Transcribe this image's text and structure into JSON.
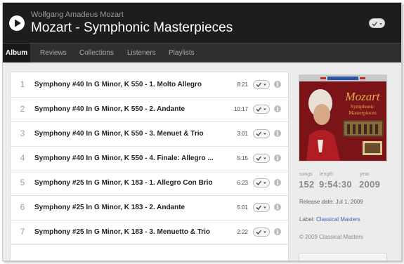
{
  "header": {
    "artist": "Wolfgang Amadeus Mozart",
    "album_title": "Mozart - Symphonic Masterpieces",
    "play_icon": "play-icon",
    "library_toggle_icon": "check-toggle-icon"
  },
  "tabs": [
    {
      "label": "Album",
      "active": true
    },
    {
      "label": "Reviews",
      "active": false
    },
    {
      "label": "Collections",
      "active": false
    },
    {
      "label": "Listeners",
      "active": false
    },
    {
      "label": "Playlists",
      "active": false
    }
  ],
  "tracks": [
    {
      "num": "1",
      "title": "Symphony #40 In G Minor, K 550 - 1. Molto Allegro",
      "duration": "8:21"
    },
    {
      "num": "2",
      "title": "Symphony #40 In G Minor, K 550 - 2. Andante",
      "duration": "10:17"
    },
    {
      "num": "3",
      "title": "Symphony #40 In G Minor, K 550 - 3. Menuet & Trio",
      "duration": "3:01"
    },
    {
      "num": "4",
      "title": "Symphony #40 In G Minor, K 550 - 4. Finale: Allegro ...",
      "duration": "5:15"
    },
    {
      "num": "5",
      "title": "Symphony #25 In G Minor, K 183 - 1. Allegro Con Brio",
      "duration": "6:23"
    },
    {
      "num": "6",
      "title": "Symphony #25 In G Minor, K 183 - 2. Andante",
      "duration": "5:01"
    },
    {
      "num": "7",
      "title": "Symphony #25 In G Minor, K 183 - 3. Menuetto & Trio",
      "duration": "2:22"
    }
  ],
  "cover": {
    "top_text": "Symphonic Masterpieces",
    "composer": "Mozart",
    "subtitle": "Symphonic Masterpieces",
    "colors": {
      "background": "#7a1418",
      "gold": "#e3b04a",
      "portrait": "#c8a070"
    }
  },
  "stats": {
    "songs_label": "songs",
    "songs": "152",
    "length_label": "length",
    "length": "9:54:30",
    "year_label": "year",
    "year": "2009"
  },
  "release": {
    "date_text": "Release date: Jul 1, 2009",
    "label_prefix": "Label:",
    "label_name": "Classical Masters",
    "copyright": "© 2009 Classical Masters"
  },
  "colors": {
    "header_bg": "#1d1d1d",
    "tabs_bg": "#2f2f2f",
    "link": "#3a66b8",
    "content_bg": "#ececec"
  }
}
